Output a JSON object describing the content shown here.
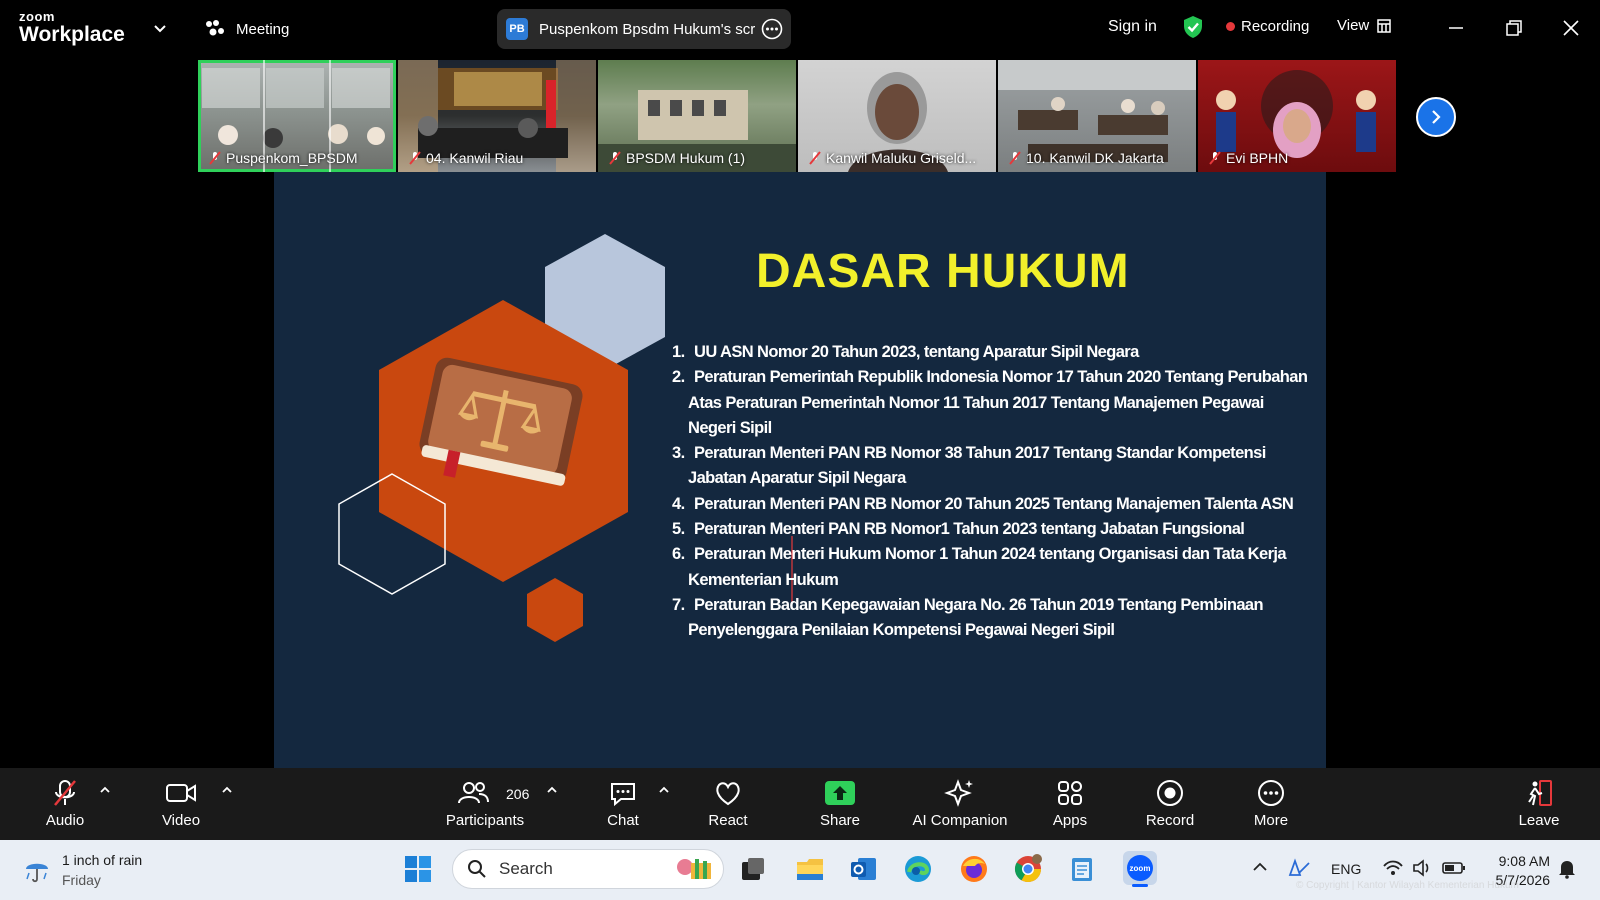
{
  "titlebar": {
    "brand_small": "zoom",
    "brand_big": "Workplace",
    "meeting_label": "Meeting",
    "share_badge": "PB",
    "share_title": "Puspenkom Bpsdm Hukum's scr",
    "sign_in": "Sign in",
    "recording": "Recording",
    "view": "View"
  },
  "participants_strip": [
    {
      "name": "Puspenkom_BPSDM",
      "active": true
    },
    {
      "name": "04. Kanwil Riau"
    },
    {
      "name": "BPSDM Hukum (1)"
    },
    {
      "name": "Kanwil Maluku Griseld..."
    },
    {
      "name": "10. Kanwil DK Jakarta"
    },
    {
      "name": "Evi BPHN"
    }
  ],
  "slide": {
    "title": "DASAR HUKUM",
    "items": [
      {
        "num": "1.",
        "text": "UU  ASN Nomor 20 Tahun 2023, tentang Aparatur Sipil Negara"
      },
      {
        "num": "2.",
        "text": "Peraturan Pemerintah Republik Indonesia Nomor 17 Tahun 2020 Tentang Perubahan Atas Peraturan Pemerintah Nomor 11 Tahun 2017 Tentang Manajemen Pegawai Negeri Sipil"
      },
      {
        "num": "3.",
        "text": "Peraturan Menteri PAN RB Nomor 38 Tahun 2017 Tentang Standar Kompetensi Jabatan Aparatur Sipil Negara"
      },
      {
        "num": "4.",
        "text": "Peraturan Menteri PAN RB Nomor 20 Tahun 2025 Tentang Manajemen Talenta ASN"
      },
      {
        "num": "5.",
        "text": "Peraturan Menteri PAN RB Nomor1 Tahun 2023 tentang Jabatan Fungsional"
      },
      {
        "num": "6.",
        "text": "Peraturan Menteri Hukum Nomor 1 Tahun 2024 tentang Organisasi dan Tata Kerja Kementerian Hukum"
      },
      {
        "num": "7.",
        "text": "Peraturan Badan Kepegawaian Negara No. 26 Tahun 2019 Tentang Pembinaan Penyelenggara Penilaian Kompetensi Pegawai Negeri Sipil"
      }
    ]
  },
  "toolbar": {
    "audio": "Audio",
    "video": "Video",
    "participants": "Participants",
    "participants_count": "206",
    "chat": "Chat",
    "react": "React",
    "share": "Share",
    "ai_companion": "AI Companion",
    "apps": "Apps",
    "record": "Record",
    "more": "More",
    "leave": "Leave"
  },
  "taskbar": {
    "weather_line1": "1 inch of rain",
    "weather_line2": "Friday",
    "search_placeholder": "Search",
    "lang": "ENG",
    "time": "9:08 AM",
    "date": "5/7/2026",
    "copyright": "© Copyright | Kantor Wilayah Kementerian Hukum"
  },
  "colors": {
    "slide_bg": "#14283f",
    "title_yellow": "#f2f02b",
    "hex_orange": "#c9480f",
    "hex_light": "#b8c6dc",
    "share_green": "#2fd05a",
    "leave_red": "#e5383b"
  }
}
